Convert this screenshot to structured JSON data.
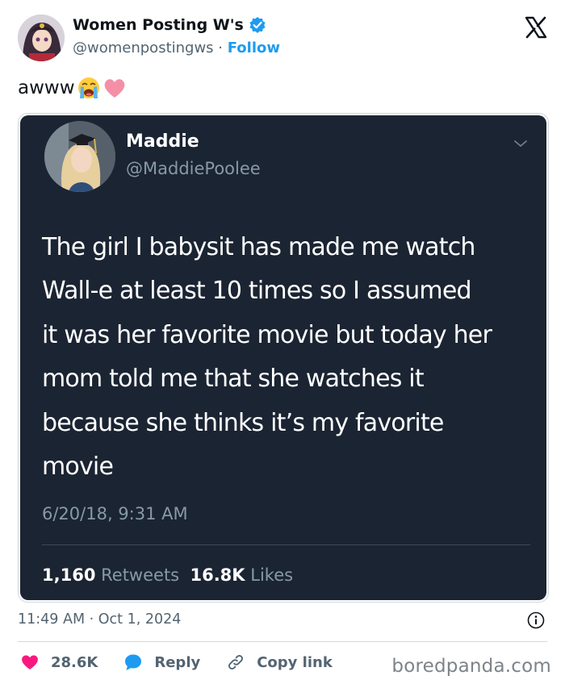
{
  "author": {
    "name": "Women Posting W's",
    "handle": "@womenpostingws",
    "separator": " · ",
    "follow_label": "Follow"
  },
  "post": {
    "text": "awww",
    "emojis": [
      "loudly-crying-face-emoji",
      "pink-heart-emoji"
    ],
    "timestamp": "11:49 AM · Oct 1, 2024"
  },
  "embedded_tweet": {
    "name": "Maddie",
    "handle": "@MaddiePoolee",
    "body": "The girl I babysit has made me watch\nWall-e at least 10 times so I assumed\nit was her favorite movie but today her\nmom told me that she watches it\nbecause she thinks it’s my favorite\nmovie",
    "timestamp": "6/20/18, 9:31 AM",
    "retweets_count": "1,160",
    "retweets_label": "Retweets",
    "likes_count": "16.8K",
    "likes_label": "Likes"
  },
  "actions": {
    "likes_count": "28.6K",
    "reply_label": "Reply",
    "copy_link_label": "Copy link"
  },
  "watermark": "boredpanda.com",
  "colors": {
    "accent": "#1d9bf0",
    "heart": "#f91880",
    "embed_bg": "#1b2432",
    "muted": "#536471"
  }
}
